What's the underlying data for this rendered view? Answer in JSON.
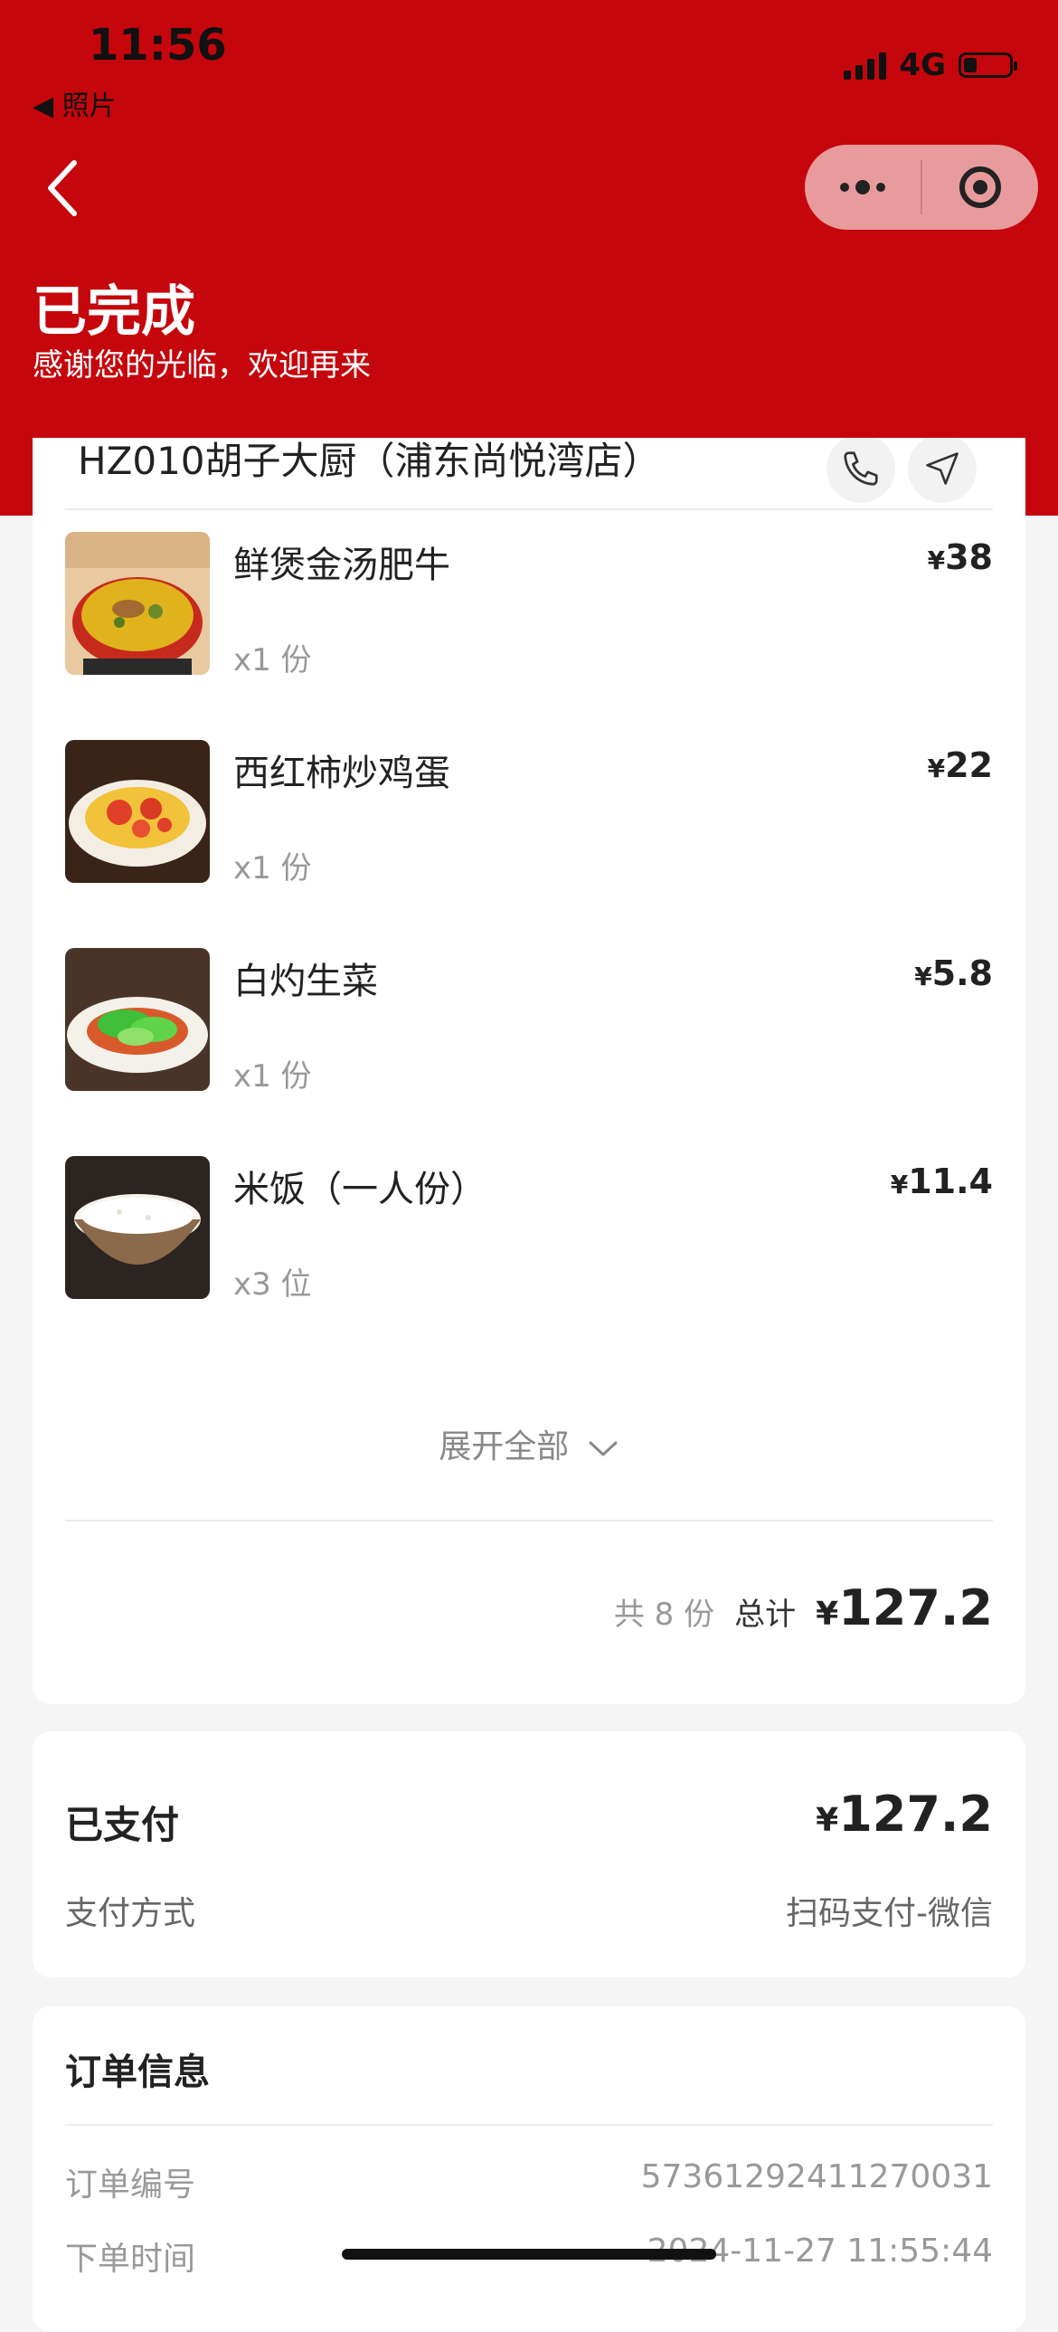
{
  "status_bar": {
    "time": "11:56",
    "back_app": "◀ 照片",
    "network": "4G",
    "battery_level": 0.3
  },
  "nav": {
    "back_icon": "chevron-left-icon",
    "more_icon": "more-dots-icon",
    "close_icon": "target-close-icon"
  },
  "header": {
    "status": "已完成",
    "subtitle": "感谢您的光临，欢迎再来",
    "bg_color": "#c5060c"
  },
  "shop": {
    "name": "HZ010胡子大厨（浦东尚悦湾店）",
    "phone_icon": "phone-icon",
    "nav_icon": "navigation-arrow-icon"
  },
  "items": [
    {
      "name": "鲜煲金汤肥牛",
      "qty": "x1 份",
      "currency": "¥",
      "price": "38",
      "image": "golden-soup-beef-image"
    },
    {
      "name": "西红柿炒鸡蛋",
      "qty": "x1 份",
      "currency": "¥",
      "price": "22",
      "image": "tomato-egg-image"
    },
    {
      "name": "白灼生菜",
      "qty": "x1 份",
      "currency": "¥",
      "price": "5.8",
      "image": "boiled-lettuce-image"
    },
    {
      "name": "米饭（一人份）",
      "qty": "x3 位",
      "currency": "¥",
      "price": "11.4",
      "image": "rice-bowl-image"
    }
  ],
  "expand_label": "展开全部",
  "totals": {
    "count": "共 8 份",
    "label": "总计",
    "currency": "¥",
    "amount": "127.2"
  },
  "payment": {
    "status": "已支付",
    "currency": "¥",
    "amount": "127.2",
    "method_label": "支付方式",
    "method_value": "扫码支付-微信"
  },
  "order_info": {
    "title": "订单信息",
    "rows": [
      {
        "label": "订单编号",
        "value": "57361292411270031"
      },
      {
        "label": "下单时间",
        "value": "2024-11-27 11:55:44"
      }
    ]
  }
}
